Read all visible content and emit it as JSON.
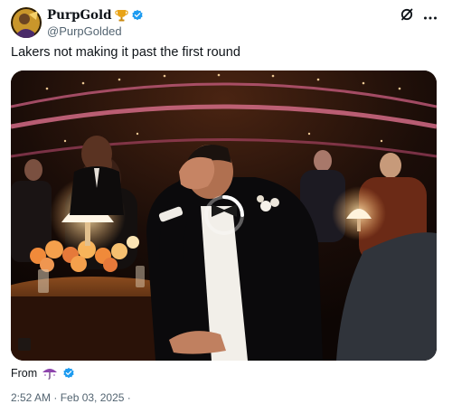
{
  "post": {
    "display_name": "PurpGold",
    "handle": "@PurpGolded",
    "text": "Lakers not making it past the first round",
    "from_label": "From",
    "meta_partial": "2:52 AM · Feb 03, 2025 ·"
  },
  "icons": {
    "trophy": "trophy-icon",
    "verified": "verified-badge-icon",
    "grok": "grok-icon",
    "more": "more-icon",
    "flag": "umbrella-flag-icon",
    "loader": "loading-spinner-icon"
  },
  "colors": {
    "verified_blue": "#1d9bf0",
    "trophy_gold": "#e8a317",
    "text_primary": "#0f1419",
    "text_secondary": "#536471",
    "flag_purple": "#8e44ad"
  },
  "media": {
    "type": "video",
    "state": "loading"
  }
}
